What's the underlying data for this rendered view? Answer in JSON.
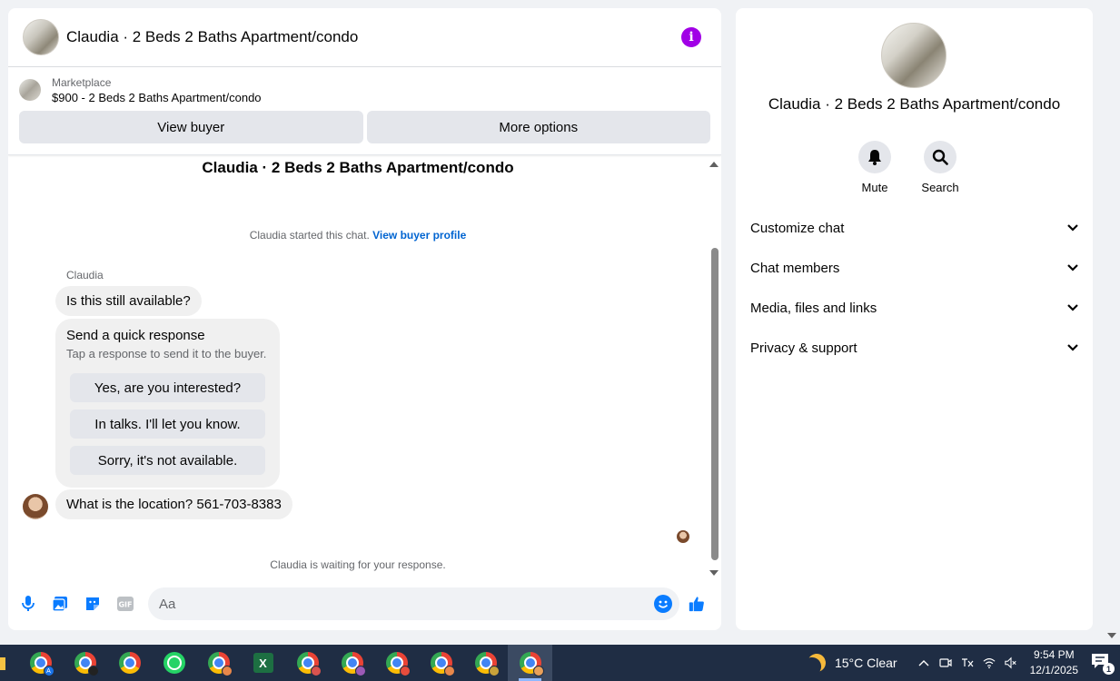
{
  "header": {
    "title": "Claudia · 2 Beds 2 Baths Apartment/condo",
    "info_icon": "info-icon"
  },
  "listing": {
    "label": "Marketplace",
    "price_title": "$900 - 2 Beds 2 Baths Apartment/condo",
    "buttons": [
      "View buyer",
      "More options"
    ]
  },
  "conversation": {
    "title": "Claudia · 2 Beds 2 Baths Apartment/condo",
    "started_text": "Claudia started this chat.",
    "started_link": "View buyer profile",
    "sender": "Claudia",
    "messages": [
      "Is this still available?",
      "What is the location? 561-703-8383"
    ],
    "quick_response": {
      "title": "Send a quick response",
      "subtitle": "Tap a response to send it to the buyer.",
      "options": [
        "Yes, are you interested?",
        "In talks. I'll let you know.",
        "Sorry, it's not available."
      ]
    },
    "waiting_text": "Claudia is waiting for your response."
  },
  "composer": {
    "placeholder": "Aa",
    "icons": [
      "microphone-icon",
      "photo-icon",
      "sticker-icon",
      "gif-icon",
      "emoji-icon",
      "thumbs-up-icon"
    ],
    "gif_label": "GIF"
  },
  "side": {
    "title": "Claudia · 2 Beds 2 Baths Apartment/condo",
    "actions": [
      {
        "label": "Mute",
        "icon": "bell-icon"
      },
      {
        "label": "Search",
        "icon": "search-icon"
      }
    ],
    "menu": [
      "Customize chat",
      "Chat members",
      "Media, files and links",
      "Privacy & support"
    ]
  },
  "taskbar": {
    "weather": "15°C  Clear",
    "time": "9:54 PM",
    "date": "12/1/2025",
    "notification_count": "1",
    "apps": [
      "chrome",
      "chrome",
      "chrome",
      "whatsapp",
      "chrome",
      "excel",
      "chrome",
      "chrome",
      "chrome",
      "chrome",
      "chrome",
      "chrome"
    ]
  },
  "colors": {
    "accent": "#a100e6",
    "messenger_blue": "#0a7cff",
    "link": "#0064d1",
    "taskbar": "#1f2d44"
  }
}
